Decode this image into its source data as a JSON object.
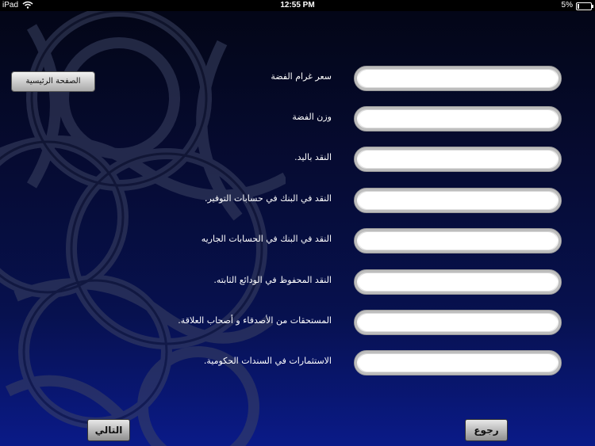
{
  "status_bar": {
    "device": "iPad",
    "time": "12:55 PM",
    "battery": "5%"
  },
  "header": {
    "home_button": "الصفحة الرئيسية"
  },
  "form": {
    "rows": [
      {
        "label": "سعر غرام الفضة",
        "value": ""
      },
      {
        "label": "وزن الفضة",
        "value": ""
      },
      {
        "label": "النقد باليد.",
        "value": ""
      },
      {
        "label": "النقد في البنك في حسابات التوفير.",
        "value": ""
      },
      {
        "label": "النقد في البنك في الحسابات الجاريه",
        "value": ""
      },
      {
        "label": "النقد المحفوظ في الودائع الثابته.",
        "value": ""
      },
      {
        "label": "المستحقات من الأصدقاء و أصحاب العلاقة.",
        "value": ""
      },
      {
        "label": "الاستثمارات في السندات الحكومية.",
        "value": ""
      }
    ]
  },
  "footer": {
    "next_button": "التالي",
    "back_button": "رجوع"
  },
  "colors": {
    "background_top": "#030617",
    "background_bottom": "#0a1a88",
    "label_text": "#ffffff"
  }
}
